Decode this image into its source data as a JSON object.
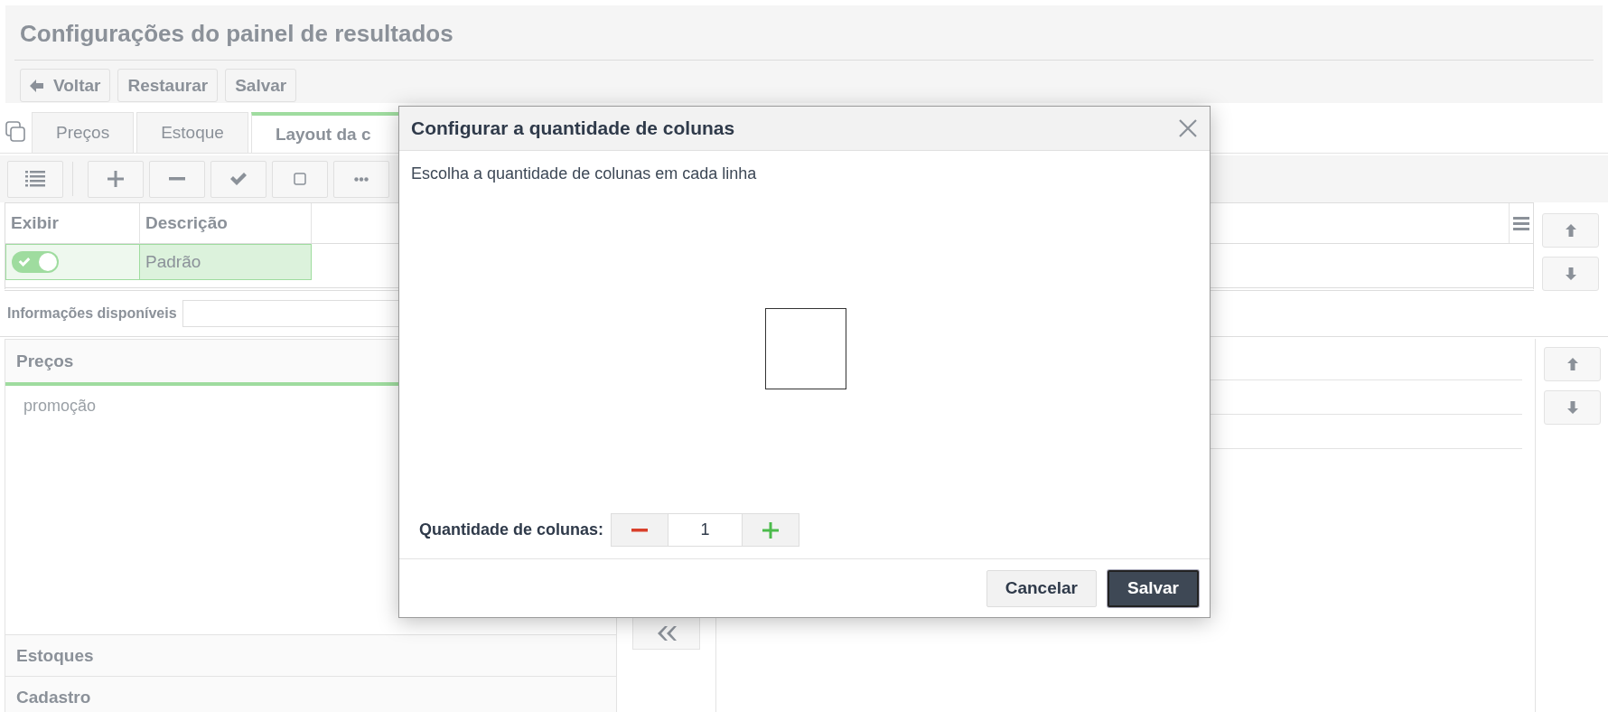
{
  "page": {
    "title": "Configurações do painel de resultados"
  },
  "header_buttons": [
    {
      "label": "Voltar",
      "kind": "back"
    },
    {
      "label": "Restaurar",
      "kind": "plain"
    },
    {
      "label": "Salvar",
      "kind": "plain"
    }
  ],
  "tabs": [
    {
      "label": "Preços",
      "selected": false
    },
    {
      "label": "Estoque",
      "selected": false
    },
    {
      "label": "Layout da c",
      "selected": true
    }
  ],
  "grid_tools": [
    {
      "kind": "list"
    },
    {
      "kind": "add"
    },
    {
      "kind": "remove"
    },
    {
      "kind": "check"
    },
    {
      "kind": "square"
    },
    {
      "kind": "more"
    }
  ],
  "layout_table": {
    "columns": [
      "Exibir",
      "Descrição"
    ],
    "rows": [
      {
        "on": true,
        "description": "Padrão",
        "selected": true
      }
    ]
  },
  "available_info": {
    "label": "Informações disponíveis"
  },
  "groups": [
    {
      "title": "Preços",
      "expanded": true,
      "items": [
        "promoção"
      ]
    },
    {
      "title": "Estoques",
      "expanded": false
    },
    {
      "title": "Cadastro",
      "expanded": false
    }
  ],
  "dialog": {
    "title": "Configurar a quantidade de colunas",
    "instruction": "Escolha a quantidade de colunas em cada linha",
    "columns_label": "Quantidade de colunas:",
    "columns_value": "1",
    "buttons": [
      {
        "label": "Cancelar",
        "kind": "secondary"
      },
      {
        "label": "Salvar",
        "kind": "primary"
      }
    ]
  }
}
